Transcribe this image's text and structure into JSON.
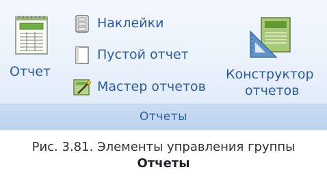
{
  "ribbon": {
    "group_label": "Отчеты",
    "buttons": {
      "report": {
        "label": "Отчет",
        "icon": "report-icon"
      },
      "labels": {
        "label": "Наклейки",
        "icon": "labels-icon"
      },
      "blank_report": {
        "label": "Пустой отчет",
        "icon": "blank-report-icon"
      },
      "report_wizard": {
        "label": "Мастер отчетов",
        "icon": "report-wizard-icon"
      },
      "report_designer": {
        "line1": "Конструктор",
        "line2": "отчетов",
        "icon": "report-designer-icon"
      }
    }
  },
  "caption": {
    "line1": "Рис. 3.81. Элементы управления группы",
    "line2": "Отчеты"
  },
  "colors": {
    "label_text": "#2b5aa6",
    "group_bar": "#c9dcf2",
    "ribbon_bg": "#eaf2fb"
  }
}
